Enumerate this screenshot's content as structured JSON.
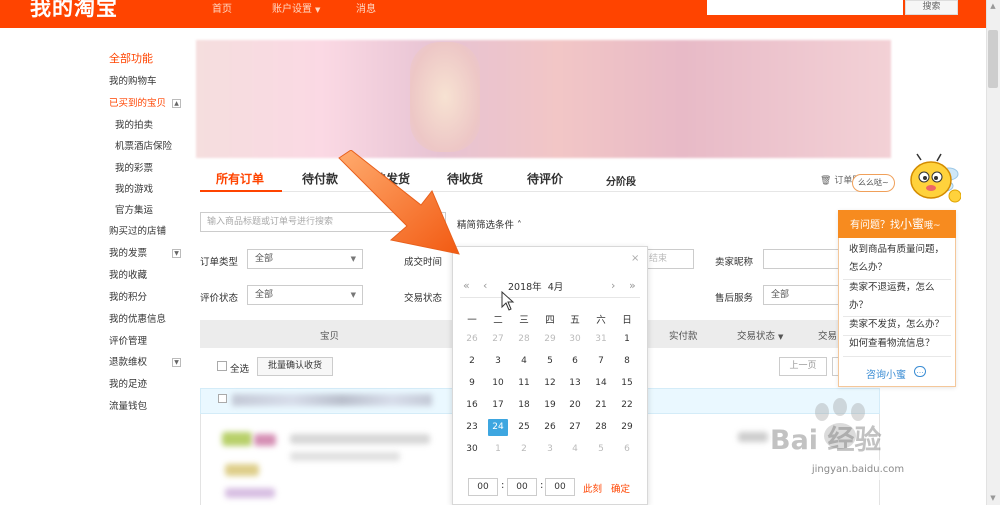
{
  "header": {
    "logo": "我的淘宝",
    "nav": [
      "首页",
      "账户设置",
      "消息"
    ],
    "search_button": "搜索"
  },
  "sidebar": {
    "title": "全部功能",
    "items": [
      "我的购物车",
      "已买到的宝贝",
      "我的拍卖",
      "机票酒店保险",
      "我的彩票",
      "我的游戏",
      "官方集运",
      "购买过的店铺",
      "我的发票",
      "我的收藏",
      "我的积分",
      "我的优惠信息",
      "评价管理",
      "退款维权",
      "我的足迹",
      "流量钱包"
    ],
    "toggles": [
      "▲",
      "▼",
      "▼"
    ]
  },
  "tabs": [
    "所有订单",
    "待付款",
    "待发货",
    "待收货",
    "待评价",
    "分阶段"
  ],
  "recycle_label": "订单回",
  "filters": {
    "search_placeholder": "输入商品标题或订单号进行搜索",
    "refine_label": "精简筛选条件 ˄",
    "order_type_label": "订单类型",
    "order_type_value": "全部",
    "deal_time_label": "成交时间",
    "deal_time_end": "结束",
    "seller_label": "卖家昵称",
    "review_label": "评价状态",
    "review_value": "全部",
    "trade_label": "交易状态",
    "after_sale_label": "售后服务",
    "after_sale_value": "全部"
  },
  "table": {
    "columns": [
      "宝贝",
      "实付款",
      "交易状态",
      "交易"
    ],
    "select_all": "全选",
    "batch_confirm": "批量确认收货",
    "prev_page": "上一页"
  },
  "datepicker": {
    "close": "×",
    "nav": [
      "«",
      "‹",
      "›",
      "»"
    ],
    "year": "2018年",
    "month": "4月",
    "weekdays": [
      "一",
      "二",
      "三",
      "四",
      "五",
      "六",
      "日"
    ],
    "weeks": [
      [
        "26",
        "27",
        "28",
        "29",
        "30",
        "31",
        "1"
      ],
      [
        "2",
        "3",
        "4",
        "5",
        "6",
        "7",
        "8"
      ],
      [
        "9",
        "10",
        "11",
        "12",
        "13",
        "14",
        "15"
      ],
      [
        "16",
        "17",
        "18",
        "19",
        "20",
        "21",
        "22"
      ],
      [
        "23",
        "24",
        "25",
        "26",
        "27",
        "28",
        "29"
      ],
      [
        "30",
        "1",
        "2",
        "3",
        "4",
        "5",
        "6"
      ]
    ],
    "selected_day": "24",
    "time": [
      "00",
      "00",
      "00"
    ],
    "now_button": "此刻",
    "ok_button": "确定"
  },
  "helper": {
    "bubble": "么么哒~",
    "header_prefix": "有问题？找",
    "header_name": "小蜜",
    "header_suffix": "哦~",
    "questions": [
      "收到商品有质量问题，",
      "怎么办？",
      "卖家不退运费，怎么",
      "办？",
      "卖家不发货，怎么办？",
      "如何查看物流信息？"
    ],
    "ask": "咨询小蜜",
    "ask_icon": "chat-icon"
  },
  "watermark": {
    "text": "Bai 经验",
    "url": "jingyan.baidu.com"
  },
  "colors": {
    "brand": "#ff4400",
    "selected_day": "#3da6e0",
    "helper": "#f78b1f"
  }
}
